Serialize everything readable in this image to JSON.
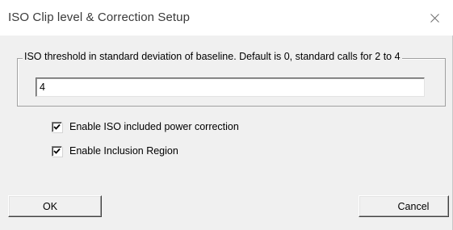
{
  "window": {
    "title": "ISO Clip level & Correction Setup",
    "close_icon": "close-icon"
  },
  "threshold_group": {
    "legend": "ISO threshold in standard deviation of baseline.  Default is 0, standard calls for 2 to 4",
    "value": "4"
  },
  "options": {
    "power_correction": {
      "label": "Enable ISO included power correction",
      "checked": true
    },
    "inclusion_region": {
      "label": "Enable Inclusion Region",
      "checked": true
    }
  },
  "buttons": {
    "ok": "OK",
    "cancel": "Cancel"
  },
  "colors": {
    "dialog_background": "#f0f0f0",
    "titlebar_background": "#ffffff"
  }
}
